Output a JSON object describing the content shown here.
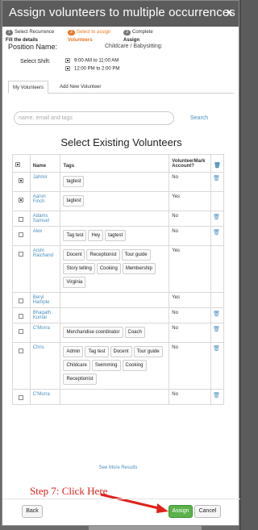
{
  "modal": {
    "title": "Assign volunteers to multiple occurrences",
    "close_label": "x"
  },
  "steps": [
    {
      "num": "1",
      "label": "Select Recurrence",
      "sub": "Fill the details"
    },
    {
      "num": "2",
      "label": "Select to assign",
      "sub": "Volunteers"
    },
    {
      "num": "3",
      "label": "Complete",
      "sub": "Assign"
    }
  ],
  "position": {
    "label": "Position Name:",
    "value": "Childcare / Babysitting:"
  },
  "shift": {
    "label": "Select Shift:",
    "options": [
      {
        "label": "9:00 AM to 11:00 AM",
        "checked": true
      },
      {
        "label": "12:00 PM to 2:00 PM",
        "checked": true
      }
    ]
  },
  "tabs": [
    {
      "label": "My Volunteers",
      "active": true
    },
    {
      "label": "Add New Volunteer",
      "active": false
    }
  ],
  "search": {
    "placeholder": "name, email and tags",
    "button_label": "Search"
  },
  "section_title": "Select Existing Volunteers",
  "table": {
    "headers": {
      "check": "☑",
      "name": "Name",
      "tags": "Tags",
      "account": "VolunteerMark Account?",
      "trash": "🗑"
    },
    "rows": [
      {
        "checked": true,
        "name": "Jahmir",
        "tags": [
          "tagtest"
        ],
        "account": "No",
        "trash": true
      },
      {
        "checked": true,
        "name": "Aaron Finch",
        "tags": [
          "tagtest"
        ],
        "account": "Yes",
        "trash": false
      },
      {
        "checked": false,
        "name": "Adams Samuel",
        "tags": [],
        "account": "No",
        "trash": true
      },
      {
        "checked": false,
        "name": "Alex",
        "tags": [
          "Tag test",
          "Hey",
          "tagtest"
        ],
        "account": "No",
        "trash": true
      },
      {
        "checked": false,
        "name": "Arohi Raichand",
        "tags": [
          "Docent",
          "Receptionist",
          "Tour guide",
          "Story telling",
          "Cooking",
          "Membership",
          "Virginia"
        ],
        "account": "Yes",
        "trash": false
      },
      {
        "checked": false,
        "name": "Beryl Hample",
        "tags": [],
        "account": "Yes",
        "trash": false
      },
      {
        "checked": false,
        "name": "Bhagath Kumar",
        "tags": [],
        "account": "No",
        "trash": true
      },
      {
        "checked": false,
        "name": "C'Morra",
        "tags": [
          "Merchandise coordinator",
          "Coach"
        ],
        "account": "No",
        "trash": true
      },
      {
        "checked": false,
        "name": "Chris",
        "tags": [
          "Admin",
          "Tag test",
          "Docent",
          "Tour guide",
          "Childcare",
          "Swimming",
          "Cooking",
          "Receptionist"
        ],
        "account": "No",
        "trash": true
      },
      {
        "checked": false,
        "name": "C'Morra",
        "tags": [],
        "account": "No",
        "trash": true
      }
    ]
  },
  "see_more_label": "See More Results",
  "annotation_text": "Step 7: Click Here",
  "footer": {
    "back_label": "Back",
    "assign_label": "Assign",
    "cancel_label": "Cancel"
  },
  "colors": {
    "header_bg": "#5c5c5c",
    "accent_orange": "#e87722",
    "link_blue": "#4a90c2",
    "assign_green": "#5bb24a",
    "annotation_red": "#e0201b"
  }
}
